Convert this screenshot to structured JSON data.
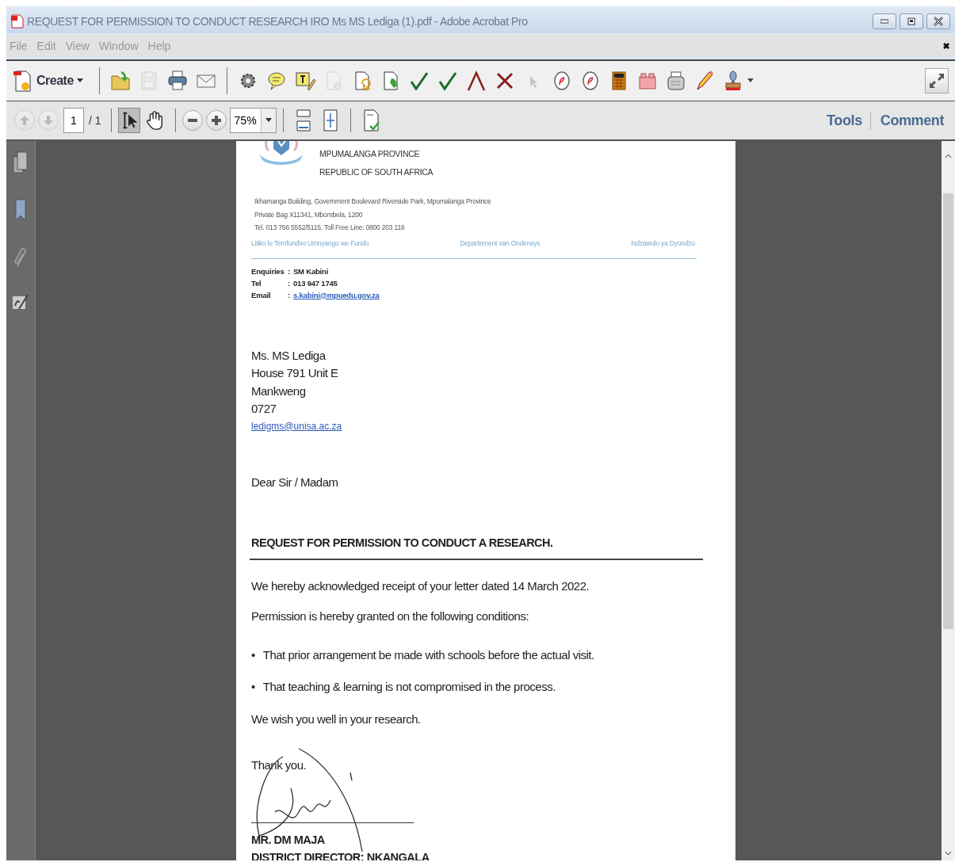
{
  "window": {
    "title": "REQUEST FOR PERMISSION TO CONDUCT RESEARCH IRO Ms MS Lediga (1).pdf - Adobe Acrobat Pro"
  },
  "menu": [
    {
      "label": "File"
    },
    {
      "label": "Edit"
    },
    {
      "label": "View"
    },
    {
      "label": "Window"
    },
    {
      "label": "Help"
    }
  ],
  "toolbar": {
    "create_label": "Create",
    "tools": [
      {
        "kind": "open",
        "disabled": false
      },
      {
        "kind": "save",
        "disabled": true
      },
      {
        "kind": "print",
        "disabled": false
      },
      {
        "kind": "email",
        "disabled": false
      },
      {
        "kind": "sep"
      },
      {
        "kind": "gear",
        "disabled": false
      },
      {
        "kind": "comment",
        "disabled": false
      },
      {
        "kind": "highlight",
        "disabled": false
      },
      {
        "kind": "docx",
        "disabled": true
      },
      {
        "kind": "docarrow",
        "disabled": false
      },
      {
        "kind": "docdown",
        "disabled": false
      },
      {
        "kind": "check",
        "disabled": false
      },
      {
        "kind": "check",
        "disabled": false
      },
      {
        "kind": "caret",
        "disabled": false
      },
      {
        "kind": "cross",
        "disabled": false
      },
      {
        "kind": "pointer",
        "disabled": true
      },
      {
        "kind": "circle",
        "disabled": false
      },
      {
        "kind": "circle",
        "disabled": false
      },
      {
        "kind": "calc",
        "disabled": false
      },
      {
        "kind": "box",
        "disabled": false
      },
      {
        "kind": "typewriter",
        "disabled": false
      },
      {
        "kind": "pencil",
        "disabled": false
      },
      {
        "kind": "stamp",
        "disabled": false
      }
    ]
  },
  "navigation": {
    "previous_disabled": true,
    "next_disabled": true,
    "page_number": "1",
    "page_total": "/ 1",
    "modes": [
      {
        "kind": "select",
        "selected": true
      },
      {
        "kind": "hand",
        "selected": false
      }
    ],
    "zoom": "75%",
    "panes": [
      {
        "label": "Tools"
      },
      {
        "label": "Comment"
      }
    ]
  },
  "letter": {
    "province": "MPUMALANGA PROVINCE",
    "country": "REPUBLIC OF SOUTH AFRICA",
    "address": [
      "Ikhamanga Building, Government Boulevard  Riverside Park, Mpumalanga Province",
      "Private Bag X11341, Mbombela, 1200",
      "Tel. 013 766 5552/5115, Toll Free Line: 0800 203 116"
    ],
    "departments": [
      "Litiko le Temfundvo  Umnyango we Fundo",
      "Departement van Onderwys",
      "Ndzawulo ya Dyondzo"
    ],
    "contacts": [
      {
        "label": "Enquiries",
        "separator": ":",
        "value": "SM Kabini",
        "link": false
      },
      {
        "label": "Tel",
        "separator": ":",
        "value": "013 947 1745",
        "link": false
      },
      {
        "label": "Email",
        "separator": ":",
        "value": "s.kabini@mpuedu.gov.za",
        "link": true
      }
    ],
    "recipient": [
      "Ms. MS Lediga",
      "House 791 Unit E",
      "Mankweng",
      "0727"
    ],
    "recipient_email": "ledigms@unisa.ac.za",
    "salutation": "Dear Sir / Madam",
    "subject": "REQUEST FOR PERMISSION TO CONDUCT A RESEARCH.",
    "paragraphs": [
      "We hereby acknowledged receipt of your letter dated 14 March 2022.",
      "Permission is hereby granted on the following conditions:"
    ],
    "conditions": [
      {
        "bullet": "•",
        "text": "That prior arrangement be made with schools before the actual visit."
      },
      {
        "bullet": "•",
        "text": "That teaching & learning is not compromised in the process."
      }
    ],
    "wish": "We wish you well in your research.",
    "closing": "Thank you.",
    "signatory": "MR. DM MAJA",
    "signatory_title": "DISTRICT DIRECTOR: NKANGALA"
  }
}
